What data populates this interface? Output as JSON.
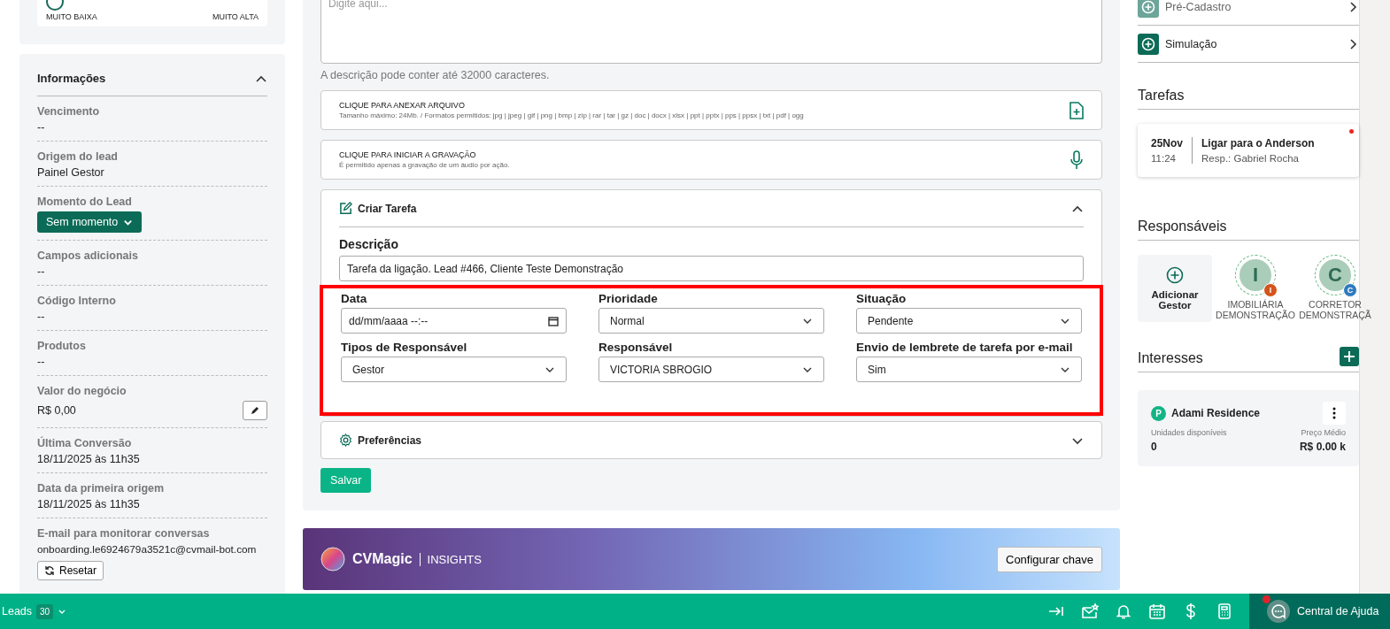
{
  "left": {
    "rating_card": {
      "min_label": "MUITO BAIXA",
      "max_label": "MUITO ALTA"
    },
    "info": {
      "title": "Informações",
      "expanded": true,
      "fields": [
        {
          "kind": "text",
          "label": "Vencimento",
          "value": "--"
        },
        {
          "kind": "text",
          "label": "Origem do lead",
          "value": "Painel Gestor"
        },
        {
          "kind": "dropdown",
          "label": "Momento do Lead",
          "value": "Sem momento"
        },
        {
          "kind": "text",
          "label": "Campos adicionais",
          "value": "--"
        },
        {
          "kind": "text",
          "label": "Código Interno",
          "value": "--"
        },
        {
          "kind": "text",
          "label": "Produtos",
          "value": "--"
        },
        {
          "kind": "editable",
          "label": "Valor do negócio",
          "value": "R$ 0,00"
        },
        {
          "kind": "text",
          "label": "Última Conversão",
          "value": "18/11/2025 às 11h35"
        },
        {
          "kind": "text",
          "label": "Data da primeira origem",
          "value": "18/11/2025 às 11h35"
        },
        {
          "kind": "resettable",
          "label": "E-mail para monitorar conversas",
          "value": "onboarding.le6924679a3521c@cvmail-bot.com",
          "button": "Resetar"
        }
      ]
    }
  },
  "middle": {
    "description": {
      "placeholder": "Digite aqui...",
      "hint": "A descrição pode conter até 32000 caracteres."
    },
    "uploads": [
      {
        "kind": "file",
        "title": "CLIQUE PARA ANEXAR ARQUIVO",
        "subtitle": "Tamanho máximo: 24Mb. / Formatos permitidos: jpg | jpeg | gif | png | bmp | zip | rar | tar | gz | doc | docx | xlsx | ppt | pptx | pps | ppsx | txt | pdf | ogg"
      },
      {
        "kind": "audio",
        "title": "CLIQUE PARA INICIAR A GRAVAÇÃO",
        "subtitle": "É permitido apenas a gravação de um áudio por ação."
      }
    ],
    "task": {
      "title": "Criar Tarefa",
      "expanded": true,
      "description_label": "Descrição",
      "description_value": "Tarefa da ligação. Lead #466, Cliente Teste Demonstração",
      "highlighted": true,
      "fields": [
        {
          "kind": "date",
          "label": "Data",
          "placeholder": "dd/mm/aaaa --:--"
        },
        {
          "kind": "select",
          "label": "Prioridade",
          "value": "Normal"
        },
        {
          "kind": "select",
          "label": "Situação",
          "value": "Pendente"
        },
        {
          "kind": "select",
          "label": "Tipos de Responsável",
          "value": "Gestor"
        },
        {
          "kind": "select",
          "label": "Responsável",
          "value": "VICTORIA SBROGIO"
        },
        {
          "kind": "select",
          "label": "Envio de lembrete de tarefa por e-mail",
          "value": "Sim"
        }
      ]
    },
    "preferences": {
      "title": "Preferências",
      "expanded": false
    },
    "save_button": "Salvar",
    "banner": {
      "brand": "CVMagic",
      "product": "INSIGHTS",
      "button": "Configurar chave"
    }
  },
  "right": {
    "actions": [
      {
        "label": "Pré-Cadastro",
        "disabled": true
      },
      {
        "label": "Simulação",
        "disabled": false
      }
    ],
    "tasks": {
      "title": "Tarefas",
      "items": [
        {
          "day": "25Nov",
          "time": "11:24",
          "title": "Ligar para o Anderson",
          "assignee": "Resp.: Gabriel Rocha",
          "unread": true
        }
      ]
    },
    "responsibles": {
      "title": "Responsáveis",
      "add_label": "Adicionar Gestor",
      "people": [
        {
          "initial": "I",
          "badge": "I",
          "color": "#d4541c",
          "name": "IMOBILIÁRIA DEMONSTRAÇÃO"
        },
        {
          "initial": "C",
          "badge": "C",
          "color": "#2e7bbf",
          "name": "CORRETOR DEMONSTRAÇÃ"
        }
      ]
    },
    "interests": {
      "title": "Interesses",
      "items": [
        {
          "badge": "P",
          "name": "Adami Residence",
          "units_label": "Unidades disponíveis",
          "units": "0",
          "price_label": "Preço Médio",
          "price": "R$ 0.00 k"
        }
      ]
    }
  },
  "bottom_bar": {
    "module": "Leads",
    "count": "30",
    "help": "Central de Ajuda",
    "help_notification": true
  }
}
